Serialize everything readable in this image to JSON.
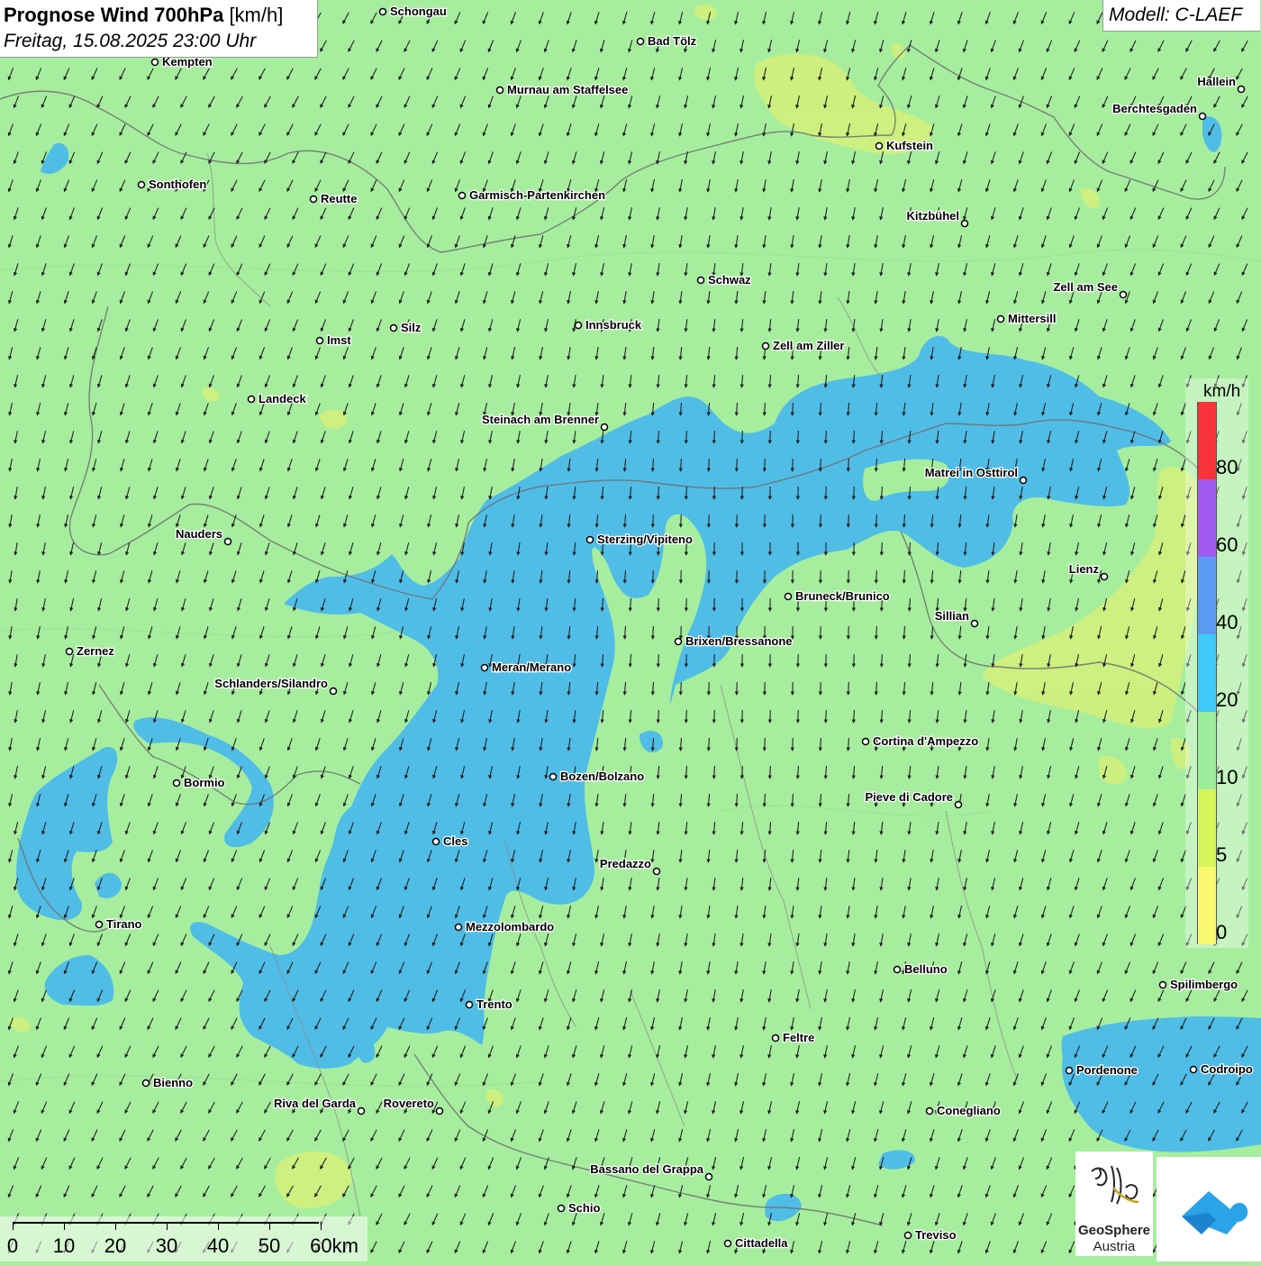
{
  "title": {
    "main": "Prognose Wind 700hPa",
    "unit": "[km/h]",
    "datetime": "Freitag, 15.08.2025 23:00 Uhr"
  },
  "model": "Modell: C-LAEF",
  "legend": {
    "unit": "km/h",
    "labels": [
      "80",
      "60",
      "40",
      "20",
      "10",
      "5",
      "0"
    ],
    "colors": [
      "#f8333a",
      "#a15af0",
      "#5b9cf2",
      "#3fc9f6",
      "#9ded9c",
      "#d7f55a",
      "#f9f86e"
    ]
  },
  "scale": {
    "labels": [
      "0",
      "10",
      "20",
      "30",
      "40",
      "50",
      "60km"
    ]
  },
  "logos": {
    "geosphere_line1": "GeoSphere",
    "geosphere_line2": "Austria"
  },
  "colors": {
    "background_calm": "#a6ee9e",
    "wind_20_40": "#49b9ee",
    "wind_5_10": "#d4f07a"
  },
  "places": [
    {
      "name": "Schongau",
      "label_side": "right"
    },
    {
      "name": "Bad Tölz",
      "label_side": "right"
    },
    {
      "name": "Kempten",
      "label_side": "right"
    },
    {
      "name": "Hallein",
      "label_side": "left"
    },
    {
      "name": "Murnau am Staffelsee",
      "label_side": "right"
    },
    {
      "name": "Berchtesgaden",
      "label_side": "left"
    },
    {
      "name": "Kufstein",
      "label_side": "right"
    },
    {
      "name": "Sonthofen",
      "label_side": "right"
    },
    {
      "name": "Reutte",
      "label_side": "right"
    },
    {
      "name": "Garmisch-Partenkirchen",
      "label_side": "right"
    },
    {
      "name": "Kitzbühel",
      "label_side": "left"
    },
    {
      "name": "Schwaz",
      "label_side": "right"
    },
    {
      "name": "Zell am See",
      "label_side": "left"
    },
    {
      "name": "Mittersill",
      "label_side": "right"
    },
    {
      "name": "Innsbruck",
      "label_side": "right"
    },
    {
      "name": "Silz",
      "label_side": "right"
    },
    {
      "name": "Imst",
      "label_side": "right"
    },
    {
      "name": "Zell am Ziller",
      "label_side": "right"
    },
    {
      "name": "Landeck",
      "label_side": "right"
    },
    {
      "name": "Steinach am Brenner",
      "label_side": "left"
    },
    {
      "name": "Matrei in Osttirol",
      "label_side": "left"
    },
    {
      "name": "Nauders",
      "label_side": "left"
    },
    {
      "name": "Sterzing/Vipiteno",
      "label_side": "right"
    },
    {
      "name": "Lienz",
      "label_side": "left"
    },
    {
      "name": "Bruneck/Brunico",
      "label_side": "right"
    },
    {
      "name": "Sillian",
      "label_side": "left"
    },
    {
      "name": "Brixen/Bressanone",
      "label_side": "right"
    },
    {
      "name": "Zernez",
      "label_side": "right"
    },
    {
      "name": "Meran/Merano",
      "label_side": "right"
    },
    {
      "name": "Schlanders/Silandro",
      "label_side": "left"
    },
    {
      "name": "Cortina d'Ampezzo",
      "label_side": "right"
    },
    {
      "name": "Bozen/Bolzano",
      "label_side": "right"
    },
    {
      "name": "Bormio",
      "label_side": "right"
    },
    {
      "name": "Pieve di Cadore",
      "label_side": "left"
    },
    {
      "name": "Cles",
      "label_side": "right"
    },
    {
      "name": "Predazzo",
      "label_side": "left"
    },
    {
      "name": "Tirano",
      "label_side": "right"
    },
    {
      "name": "Mezzolombardo",
      "label_side": "right"
    },
    {
      "name": "Belluno",
      "label_side": "right"
    },
    {
      "name": "Spilimbergo",
      "label_side": "right"
    },
    {
      "name": "Trento",
      "label_side": "right"
    },
    {
      "name": "Feltre",
      "label_side": "right"
    },
    {
      "name": "Pordenone",
      "label_side": "right"
    },
    {
      "name": "Codroipo",
      "label_side": "right"
    },
    {
      "name": "Bienno",
      "label_side": "right"
    },
    {
      "name": "Riva del Garda",
      "label_side": "left"
    },
    {
      "name": "Rovereto",
      "label_side": "left"
    },
    {
      "name": "Conegliano",
      "label_side": "right"
    },
    {
      "name": "Bassano del Grappa",
      "label_side": "left"
    },
    {
      "name": "Schio",
      "label_side": "right"
    },
    {
      "name": "Treviso",
      "label_side": "right"
    },
    {
      "name": "Cittadella",
      "label_side": "right"
    }
  ]
}
